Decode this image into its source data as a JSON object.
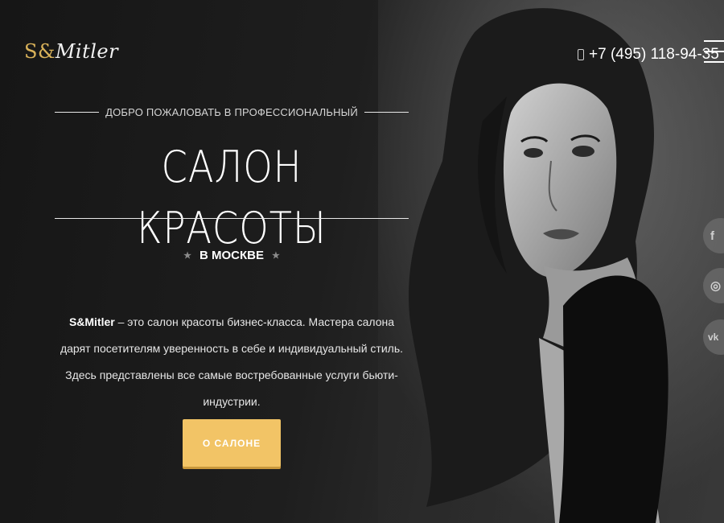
{
  "header": {
    "logo_part1": "S&",
    "logo_part2": "Mitler",
    "phone": "+7 (495) 118-94-35"
  },
  "hero": {
    "welcome": "ДОБРО ПОЖАЛОВАТЬ В ПРОФЕССИОНАЛЬНЫЙ",
    "title": "САЛОН КРАСОТЫ",
    "city": "В МОСКВЕ",
    "desc_brand": "S&Mitler",
    "desc_text": " – это салон красоты бизнес-класса. Мастера салона дарят посетителям уверенность в себе и индивидуальный стиль. Здесь представлены все самые востребованные услуги бьюти-индустрии.",
    "cta_label": "О САЛОНЕ"
  },
  "social": {
    "facebook": "f",
    "instagram": "◎",
    "vk": "vk"
  },
  "colors": {
    "accent": "#f2c466",
    "logo_gold": "#d9b25a"
  }
}
